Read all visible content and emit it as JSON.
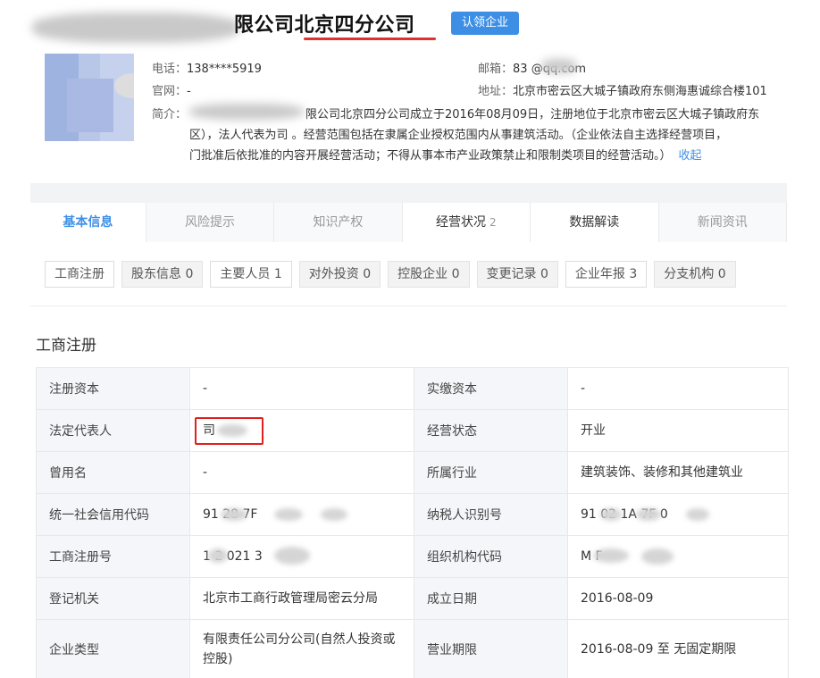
{
  "header": {
    "company_name": "限公司北京四分公司",
    "claim_button": "认领企业"
  },
  "contact": {
    "phone_label": "电话：",
    "phone_value": "138****5919",
    "email_label": "邮箱：",
    "email_value": "83 @qq.com",
    "website_label": "官网：",
    "website_value": "-",
    "address_label": "地址：",
    "address_value": "北京市密云区大城子镇政府东侧海惠诚综合楼101"
  },
  "intro": {
    "label": "简介：",
    "line1": "限公司北京四分公司成立于2016年08月09日，注册地位于北京市密云区大城子镇政府东",
    "line2": "区），法人代表为司 。经营范围包括在隶属企业授权范围内从事建筑活动。（企业依法自主选择经营项目，",
    "line3": "门批准后依批准的内容开展经营活动；不得从事本市产业政策禁止和限制类项目的经营活动。）",
    "collapse": "收起"
  },
  "tabs": [
    {
      "label": "基本信息",
      "count": ""
    },
    {
      "label": "风险提示",
      "count": ""
    },
    {
      "label": "知识产权",
      "count": ""
    },
    {
      "label": "经营状况",
      "count": "2"
    },
    {
      "label": "数据解读",
      "count": ""
    },
    {
      "label": "新闻资讯",
      "count": ""
    }
  ],
  "subtabs": [
    {
      "label": "工商注册",
      "count": ""
    },
    {
      "label": "股东信息",
      "count": "0"
    },
    {
      "label": "主要人员",
      "count": "1"
    },
    {
      "label": "对外投资",
      "count": "0"
    },
    {
      "label": "控股企业",
      "count": "0"
    },
    {
      "label": "变更记录",
      "count": "0"
    },
    {
      "label": "企业年报",
      "count": "3"
    },
    {
      "label": "分支机构",
      "count": "0"
    }
  ],
  "section_title": "工商注册",
  "registration": {
    "rows": [
      {
        "k1": "注册资本",
        "v1": "-",
        "k2": "实缴资本",
        "v2": "-"
      },
      {
        "k1": "法定代表人",
        "v1": "司",
        "k2": "经营状态",
        "v2": "开业"
      },
      {
        "k1": "曾用名",
        "v1": "-",
        "k2": "所属行业",
        "v2": "建筑装饰、装修和其他建筑业"
      },
      {
        "k1": "统一社会信用代码",
        "v1": "91 28 7F",
        "k2": "纳税人识别号",
        "v2": "91 02 1A 7F 0"
      },
      {
        "k1": "工商注册号",
        "v1": "1 2 021 3",
        "k2": "组织机构代码",
        "v2": "M F"
      },
      {
        "k1": "登记机关",
        "v1": "北京市工商行政管理局密云分局",
        "k2": "成立日期",
        "v2": "2016-08-09"
      },
      {
        "k1": "企业类型",
        "v1": "有限责任公司分公司(自然人投资或控股)",
        "k2": "营业期限",
        "v2": "2016-08-09 至 无固定期限"
      }
    ]
  },
  "colors": {
    "accent": "#3d8fe6",
    "highlight_red": "#e02020"
  }
}
